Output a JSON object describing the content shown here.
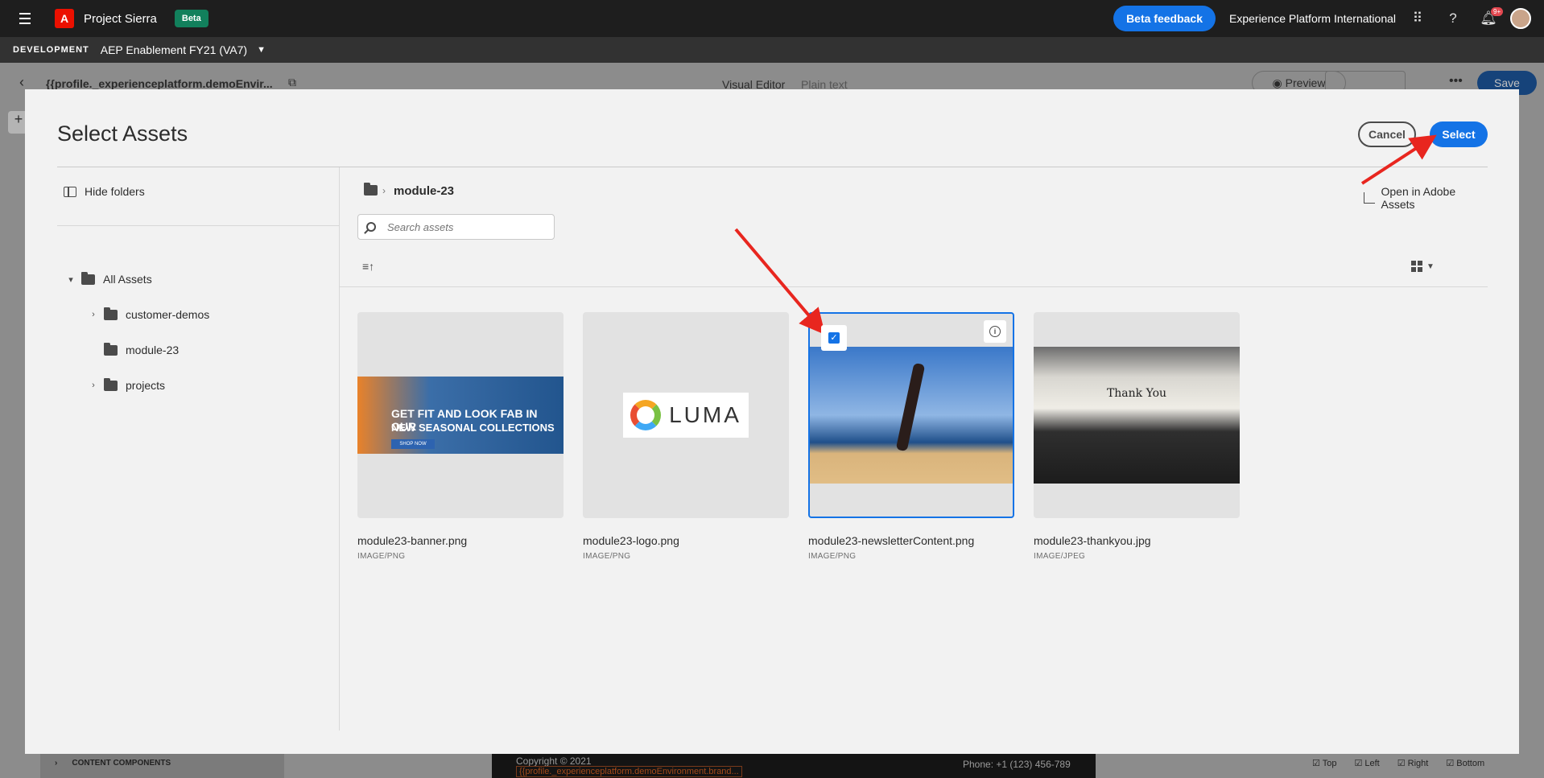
{
  "shell": {
    "app_name": "Project Sierra",
    "beta_badge": "Beta",
    "feedback_label": "Beta feedback",
    "org_name": "Experience Platform International",
    "notification_count": "9+"
  },
  "sandbox": {
    "env_label": "DEVELOPMENT",
    "name": "AEP Enablement FY21 (VA7)"
  },
  "editor": {
    "title": "{{profile._experienceplatform.demoEnvir...",
    "tab_visual": "Visual Editor",
    "tab_plain": "Plain text",
    "preview_label": "Preview",
    "save_label": "Save",
    "content_components_label": "CONTENT COMPONENTS",
    "footer_copyright": "Copyright © 2021",
    "footer_brand": "{{profile._experienceplatform.demoEnvironment.brand...",
    "footer_phone": "Phone: +1 (123) 456-789",
    "border_checks": [
      "Top",
      "Left",
      "Right",
      "Bottom"
    ]
  },
  "modal": {
    "title": "Select Assets",
    "cancel_label": "Cancel",
    "select_label": "Select",
    "hide_folders_label": "Hide folders",
    "open_in_adobe_label": "Open in Adobe Assets",
    "breadcrumb_current": "module-23",
    "search_placeholder": "Search assets",
    "tree": {
      "root": "All Assets",
      "children": [
        "customer-demos",
        "module-23",
        "projects"
      ]
    },
    "assets": [
      {
        "name": "module23-banner.png",
        "type": "IMAGE/PNG",
        "selected": false
      },
      {
        "name": "module23-logo.png",
        "type": "IMAGE/PNG",
        "selected": false
      },
      {
        "name": "module23-newsletterContent.png",
        "type": "IMAGE/PNG",
        "selected": true
      },
      {
        "name": "module23-thankyou.jpg",
        "type": "IMAGE/JPEG",
        "selected": false
      }
    ],
    "banner_text": {
      "line1": "GET FIT AND LOOK FAB IN OUR",
      "line2": "NEW SEASONAL COLLECTIONS",
      "cta": "SHOP NOW"
    },
    "logo_text": "LUMA",
    "thankyou_text": "Thank You"
  },
  "colors": {
    "accent": "#1473e6",
    "annotation_arrow": "#e8261f",
    "beta_badge": "#12805c"
  }
}
